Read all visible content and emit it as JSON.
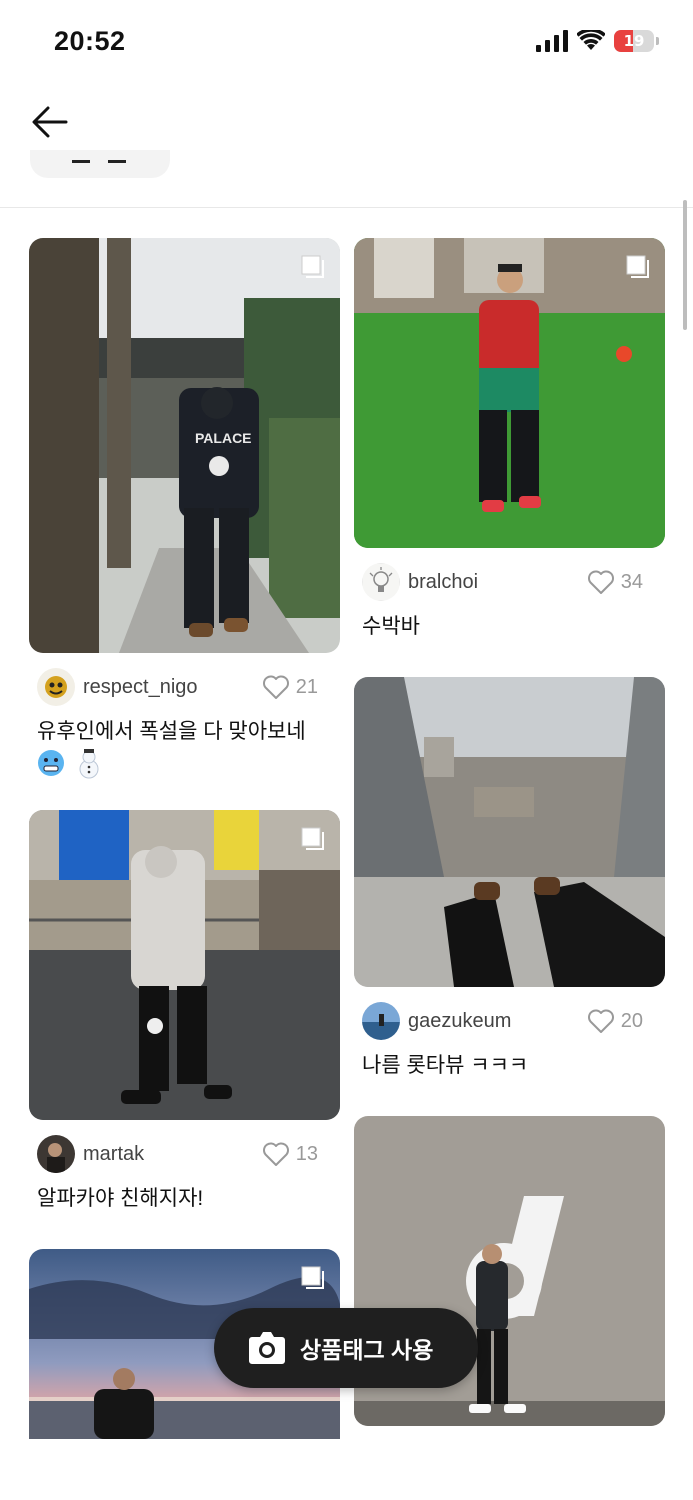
{
  "status_bar": {
    "time": "20:52",
    "battery": "19",
    "icons": [
      "signal-icon",
      "wifi-icon",
      "battery-icon"
    ]
  },
  "nav": {
    "back_icon": "arrow-left-icon"
  },
  "posts": [
    {
      "username": "respect_nigo",
      "likes": "21",
      "caption": "유후인에서 폭설을 다 맞아보네",
      "emoji": [
        "cold-face",
        "snowman"
      ],
      "multi": true
    },
    {
      "username": "bralchoi",
      "likes": "34",
      "caption": "수박바",
      "multi": true
    },
    {
      "username": "martak",
      "likes": "13",
      "caption": "알파카야 친해지자!",
      "multi": true
    },
    {
      "username": "gaezukeum",
      "likes": "20",
      "caption": "나름 롯타뷰 ㅋㅋㅋ",
      "multi": false
    },
    {
      "multi": true
    },
    {
      "multi": false
    }
  ],
  "fab": {
    "label": "상품태그 사용",
    "icon": "camera-icon"
  },
  "colors": {
    "battery_low": "#e8413f",
    "fab_bg": "#1f1f1f",
    "like_gray": "#999999"
  }
}
